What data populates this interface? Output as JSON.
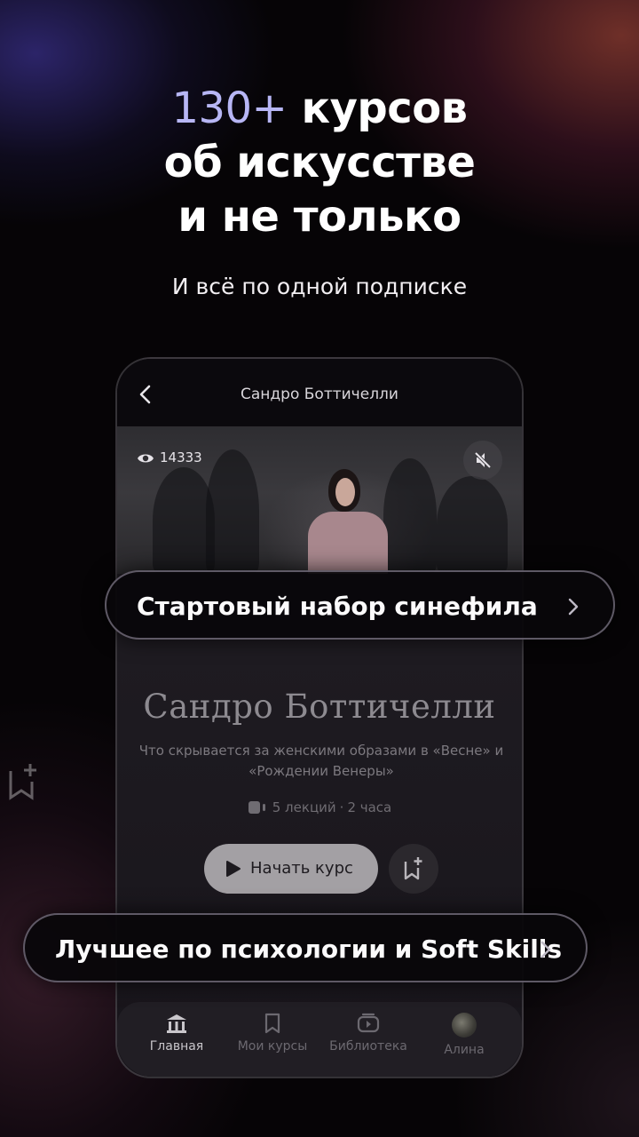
{
  "promo": {
    "headline_accent": "130+",
    "headline_line1_rest": " курсов",
    "headline_line2": "об искусстве",
    "headline_line3": "и не только",
    "subtitle": "И всё по одной подписке"
  },
  "phone": {
    "header_title": "Сандро Боттичелли",
    "video": {
      "view_count": "14333"
    },
    "course": {
      "title": "Сандро Боттичелли",
      "description": "Что скрывается за женскими образами в «Весне» и «Рождении Венеры»",
      "lectures": "5 лекций",
      "separator": "·",
      "duration": "2 часа",
      "start_label": "Начать курс"
    },
    "tabbar": {
      "items": [
        {
          "label": "Главная",
          "icon": "home-icon",
          "active": true
        },
        {
          "label": "Мои курсы",
          "icon": "bookmark-icon",
          "active": false
        },
        {
          "label": "Библиотека",
          "icon": "library-icon",
          "active": false
        },
        {
          "label": "Алина",
          "icon": "avatar",
          "active": false
        }
      ]
    }
  },
  "pills": [
    {
      "label": "Стартовый набор синефила"
    },
    {
      "label": "Лучшее по психологии и Soft Skills"
    }
  ],
  "colors": {
    "accent": "#b7b6f5",
    "background": "#060406",
    "pill_border": "#c8bed7"
  }
}
